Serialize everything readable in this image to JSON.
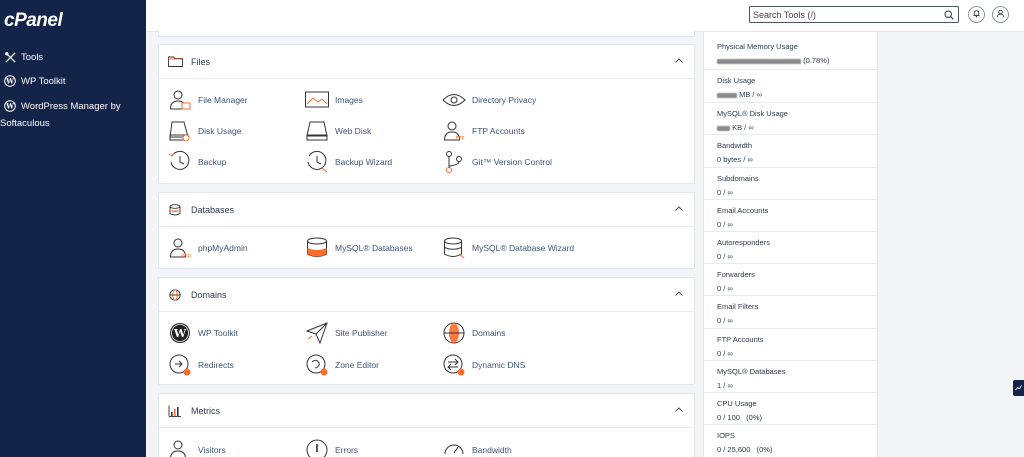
{
  "brand": {
    "logo_text": "cPanel"
  },
  "sidebar": {
    "items": [
      {
        "label": "Tools",
        "icon": "tools-icon"
      },
      {
        "label": "WP Toolkit",
        "icon": "wordpress-icon"
      },
      {
        "label": "WordPress Manager by Softaculous",
        "icon": "wordpress-icon"
      }
    ]
  },
  "header": {
    "search_placeholder": "Search Tools (/)",
    "icons": [
      "search-icon",
      "bell-icon",
      "user-icon"
    ]
  },
  "sections": {
    "files": {
      "title": "Files",
      "tools": [
        "File Manager",
        "Images",
        "Directory Privacy",
        "Disk Usage",
        "Web Disk",
        "FTP Accounts",
        "Backup",
        "Backup Wizard",
        "Git™ Version Control"
      ]
    },
    "databases": {
      "title": "Databases",
      "tools": [
        "phpMyAdmin",
        "MySQL® Databases",
        "MySQL® Database Wizard"
      ]
    },
    "domains": {
      "title": "Domains",
      "tools": [
        "WP Toolkit",
        "Site Publisher",
        "Domains",
        "Redirects",
        "Zone Editor",
        "Dynamic DNS"
      ]
    },
    "metrics": {
      "title": "Metrics",
      "tools": [
        "Visitors",
        "Errors",
        "Bandwidth"
      ]
    }
  },
  "stats": [
    {
      "label": "Physical Memory Usage",
      "value": "(0.78%)"
    },
    {
      "label": "Disk Usage",
      "value": "MB / ∞"
    },
    {
      "label": "MySQL® Disk Usage",
      "value": "KB / ∞"
    },
    {
      "label": "Bandwidth",
      "value": "0 bytes / ∞"
    },
    {
      "label": "Subdomains",
      "value": "0 / ∞"
    },
    {
      "label": "Email Accounts",
      "value": "0 / ∞"
    },
    {
      "label": "Autoresponders",
      "value": "0 / ∞"
    },
    {
      "label": "Forwarders",
      "value": "0 / ∞"
    },
    {
      "label": "Email Filters",
      "value": "0 / ∞"
    },
    {
      "label": "FTP Accounts",
      "value": "0 / ∞"
    },
    {
      "label": "MySQL® Databases",
      "value": "1 / ∞"
    },
    {
      "label": "CPU Usage",
      "value": "0 / 100   (0%)"
    },
    {
      "label": "IOPS",
      "value": "0 / 25,600   (0%)"
    }
  ],
  "colors": {
    "sidebar_bg": "#142449",
    "accent": "#ff6c2c",
    "link": "#3e5576"
  }
}
